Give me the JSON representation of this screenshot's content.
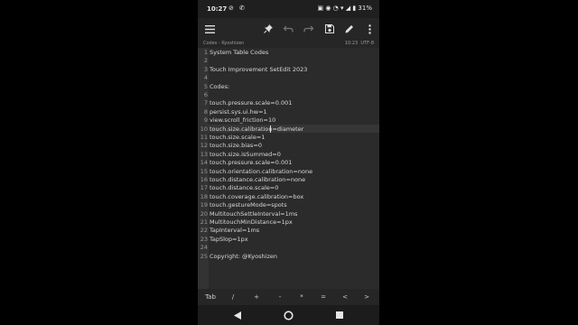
{
  "status_bar": {
    "time": "10:27",
    "left_icons": "⊘ ✆",
    "right_icons": "▣ ◉ ◔ ▾ ◢ ▮ 31%"
  },
  "toolbar": {
    "menu_icon": "menu-icon",
    "pin_icon": "pin-icon",
    "undo_icon": "undo-icon",
    "redo_icon": "redo-icon",
    "save_icon": "save-icon",
    "edit_icon": "pencil-icon",
    "more_icon": "more-vert-icon"
  },
  "file_info": {
    "name": "Codes - Kyoshizen",
    "time": "10:23",
    "encoding": "UTF-8"
  },
  "editor": {
    "lines": [
      {
        "n": "1",
        "text": "System Table Codes"
      },
      {
        "n": "2",
        "text": ""
      },
      {
        "n": "3",
        "text": "Touch Improvement SetEdit 2023"
      },
      {
        "n": "4",
        "text": ""
      },
      {
        "n": "5",
        "text": "Codes:"
      },
      {
        "n": "6",
        "text": ""
      },
      {
        "n": "7",
        "text": "touch.pressure.scale=0.001"
      },
      {
        "n": "8",
        "text": "persist.sys.ui.hw=1"
      },
      {
        "n": "9",
        "text": "view.scroll_friction=10"
      },
      {
        "n": "10",
        "text": "touch.size.calibration=diameter"
      },
      {
        "n": "11",
        "text": "touch.size.scale=1"
      },
      {
        "n": "12",
        "text": "touch.size.bias=0"
      },
      {
        "n": "13",
        "text": "touch.size.isSummed=0"
      },
      {
        "n": "14",
        "text": "touch.pressure.scale=0.001"
      },
      {
        "n": "15",
        "text": "touch.orientation.calibration=none"
      },
      {
        "n": "16",
        "text": "touch.distance.calibration=none"
      },
      {
        "n": "17",
        "text": "touch.distance.scale=0"
      },
      {
        "n": "18",
        "text": "touch.coverage.calibration=box"
      },
      {
        "n": "19",
        "text": "touch.gestureMode=spots"
      },
      {
        "n": "20",
        "text": "MultitouchSettleInterval=1ms"
      },
      {
        "n": "21",
        "text": "MultitouchMinDistance=1px"
      },
      {
        "n": "22",
        "text": "TapInterval=1ms"
      },
      {
        "n": "23",
        "text": "TapSlop=1px"
      },
      {
        "n": "24",
        "text": ""
      },
      {
        "n": "25",
        "text": "Copyright: @Kyoshizen"
      }
    ],
    "current_line": 10
  },
  "key_bar": [
    "Tab",
    "/",
    "+",
    "-",
    "*",
    "=",
    "<",
    ">"
  ],
  "nav_bar": {
    "back": "back-icon",
    "home": "home-icon",
    "recents": "recents-icon"
  }
}
